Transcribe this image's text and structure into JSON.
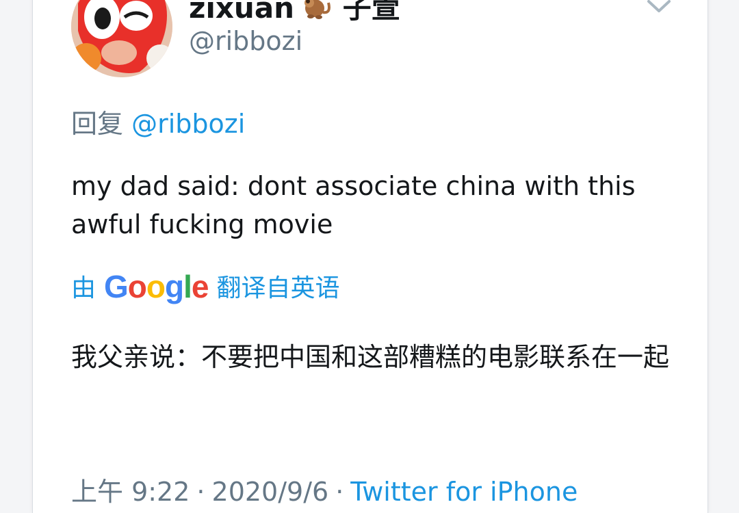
{
  "author": {
    "display_name": "zixuan",
    "display_name_suffix": "子萱",
    "emoji": "monkey-icon",
    "handle": "@ribbozi"
  },
  "reply": {
    "prefix": "回复",
    "to_handle": "@ribbozi"
  },
  "tweet": {
    "text": "my dad said: dont associate china with this awful fucking movie"
  },
  "translation": {
    "by_label": "由",
    "provider": "Google",
    "suffix": "翻译自英语",
    "text": "我父亲说：不要把中国和这部糟糕的电影联系在一起"
  },
  "meta": {
    "time": "上午 9:22",
    "date": "2020/9/6",
    "separator": "·",
    "source": "Twitter for iPhone"
  },
  "colors": {
    "link": "#1b95e0",
    "secondary_text": "#657786",
    "primary_text": "#14171a"
  }
}
